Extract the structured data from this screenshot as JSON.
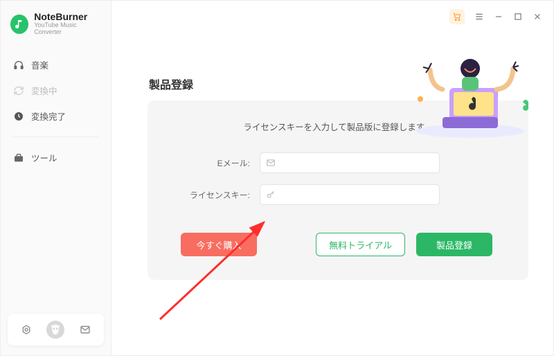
{
  "brand": {
    "name": "NoteBurner",
    "subtitle": "YouTube Music Converter"
  },
  "nav": {
    "items": [
      {
        "label": "音楽"
      },
      {
        "label": "変換中"
      },
      {
        "label": "変換完了"
      }
    ],
    "tools": "ツール"
  },
  "page": {
    "title": "製品登録",
    "hint": "ライセンスキーを入力して製品版に登録します。",
    "email_label": "Eメール:",
    "license_label": "ライセンスキー:"
  },
  "actions": {
    "buy": "今すぐ購入",
    "trial": "無料トライアル",
    "register": "製品登録"
  },
  "form": {
    "email": "",
    "license": ""
  }
}
